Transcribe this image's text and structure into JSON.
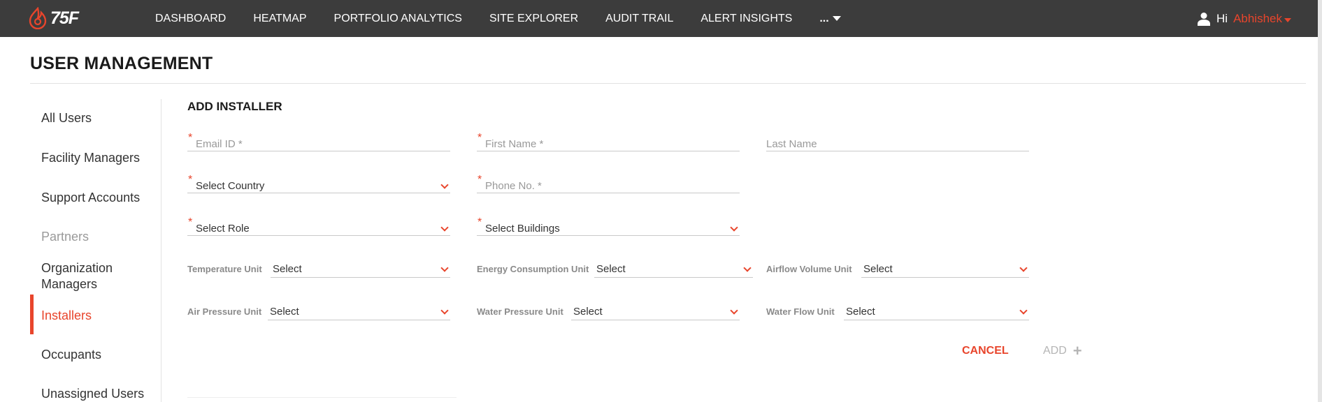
{
  "app": {
    "logo_text": "75F"
  },
  "nav": {
    "items": [
      "DASHBOARD",
      "HEATMAP",
      "PORTFOLIO ANALYTICS",
      "SITE EXPLORER",
      "AUDIT TRAIL",
      "ALERT INSIGHTS"
    ],
    "more_label": "..."
  },
  "user": {
    "greeting": "Hi",
    "name": "Abhishek"
  },
  "page": {
    "title": "USER MANAGEMENT"
  },
  "sidebar": {
    "items": [
      {
        "label": "All Users"
      },
      {
        "label": "Facility Managers"
      },
      {
        "label": "Support Accounts"
      },
      {
        "label": "Partners"
      },
      {
        "label": "Organization Managers"
      },
      {
        "label": "Installers"
      },
      {
        "label": "Occupants"
      },
      {
        "label": "Unassigned Users"
      }
    ]
  },
  "form": {
    "title": "ADD INSTALLER",
    "required_mark": "*",
    "email_placeholder": "Email ID *",
    "first_name_placeholder": "First Name *",
    "last_name_placeholder": "Last Name",
    "country_value": "Select Country",
    "phone_placeholder": "Phone No. *",
    "role_value": "Select Role",
    "buildings_value": "Select Buildings",
    "units": {
      "temperature_label": "Temperature Unit",
      "energy_label": "Energy Consumption Unit",
      "airflow_label": "Airflow Volume Unit",
      "air_pressure_label": "Air Pressure Unit",
      "water_pressure_label": "Water Pressure Unit",
      "water_flow_label": "Water Flow Unit",
      "select_value": "Select"
    },
    "cancel_label": "CANCEL",
    "add_label": "ADD",
    "add_plus": "+"
  },
  "colors": {
    "accent": "#e8452c",
    "topbar": "#3c3c3c"
  }
}
